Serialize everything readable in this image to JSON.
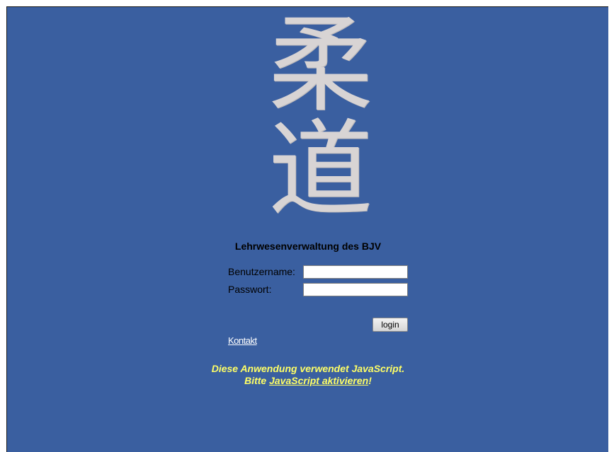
{
  "logo": {
    "kanji_top": "柔",
    "kanji_bottom": "道"
  },
  "title": "Lehrwesenverwaltung des BJV",
  "form": {
    "username_label": "Benutzername:",
    "username_value": "",
    "password_label": "Passwort:",
    "password_value": "",
    "login_label": "login"
  },
  "links": {
    "contact": "Kontakt"
  },
  "notice": {
    "line1": "Diese Anwendung verwendet JavaScript.",
    "line2_prefix": "Bitte ",
    "line2_link": "JavaScript aktivieren",
    "line2_suffix": "!"
  },
  "colors": {
    "background": "#3a5fa0",
    "notice_text": "#ffff66",
    "kanji": "#d8d4d4"
  }
}
